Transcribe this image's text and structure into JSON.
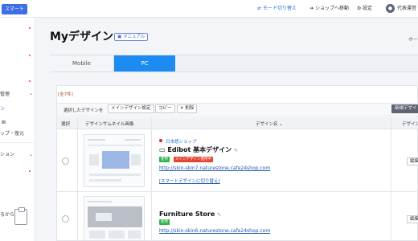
{
  "topbar": {
    "brand": "スマート",
    "mode_switch": "モード切り替え",
    "shop_move": "ショップへ移動",
    "settings": "設定",
    "user": "代表運営"
  },
  "sidebar": {
    "items": [
      {
        "label": "管理"
      },
      {
        "label": "ン"
      },
      {
        "label": "⊠"
      },
      {
        "label": "ップ・復元"
      },
      {
        "label": "ション"
      },
      {
        "label": ""
      },
      {
        "label": "るから"
      }
    ]
  },
  "page": {
    "title": "Myデザイン",
    "manual_badge": "マニュアル",
    "breadcrumb": "ホー"
  },
  "tabs": [
    {
      "label": "Mobile"
    },
    {
      "label": "PC"
    }
  ],
  "list": {
    "count_prefix": "[全",
    "count": "7",
    "count_suffix": "件]",
    "selected_label": "選択したデザインを",
    "btn_main_design": "メインデザイン設定",
    "btn_copy": "コピー",
    "btn_delete": "✕ 削除",
    "btn_new": "新規デザイ",
    "columns": {
      "select": "選択",
      "thumbnail": "デザインサムネイル画像",
      "name": "デザイン名",
      "extra": "デザイン"
    }
  },
  "rows": [
    {
      "shop_tag": "日本語ショップ",
      "name": "Edibot 基本デザイン",
      "tag_using": "使用",
      "tag_main": "メインデザイン使用中",
      "url": "http://skin-skin7.naturestone.cafe24shop.com",
      "switch_link": "[スマートデザインに切り替え]",
      "edit": "編集"
    },
    {
      "name": "Furniture Store",
      "tag_using": "使用",
      "url": "http://skin-skin6.naturestone.cafe24shop.com",
      "edit": "編集"
    }
  ],
  "colors": {
    "accent": "#1c8cf2",
    "link": "#1f58b3",
    "tag_green": "#2fb34a",
    "tag_red": "#e6432f"
  },
  "icons": [
    "mode-switch-icon",
    "arrow-right-icon",
    "gear-icon",
    "user-avatar-icon",
    "clipboard-icon",
    "edit-pencil-icon",
    "flag-icon"
  ]
}
